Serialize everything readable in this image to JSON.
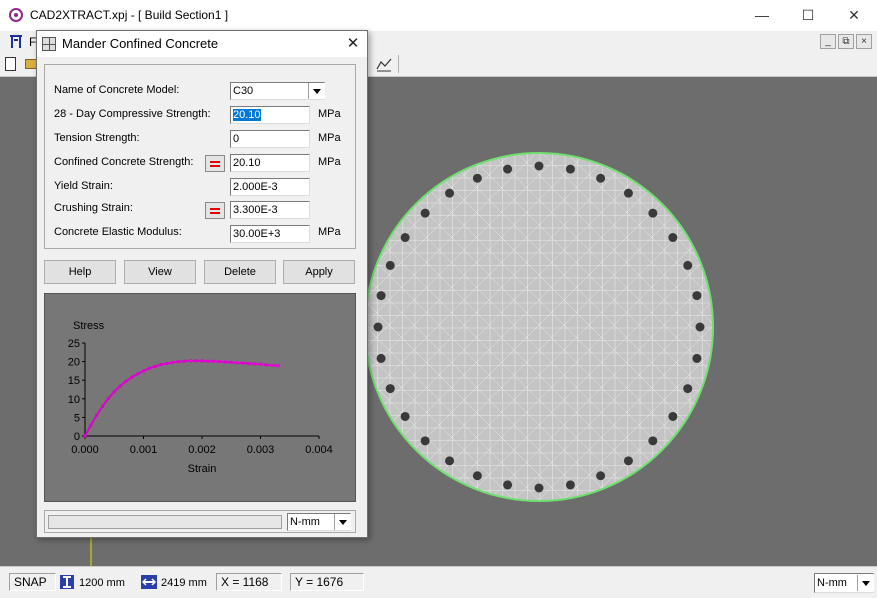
{
  "app": {
    "title": "CAD2XTRACT.xpj - [ Build Section1 ]"
  },
  "menu": {
    "first_item": "F"
  },
  "dialog": {
    "title": "Mander Confined Concrete",
    "fields": {
      "model_label": "Name of Concrete Model:",
      "model_value": "C30",
      "compressive_label": "28 - Day Compressive Strength:",
      "compressive_value": "20.10",
      "compressive_unit": "MPa",
      "tension_label": "Tension Strength:",
      "tension_value": "0",
      "tension_unit": "MPa",
      "confined_label": "Confined Concrete Strength:",
      "confined_value": "20.10",
      "confined_unit": "MPa",
      "yield_label": "Yield Strain:",
      "yield_value": "2.000E-3",
      "crushing_label": "Crushing Strain:",
      "crushing_value": "3.300E-3",
      "modulus_label": "Concrete Elastic Modulus:",
      "modulus_value": "30.00E+3",
      "modulus_unit": "MPa"
    },
    "buttons": {
      "help": "Help",
      "view": "View",
      "delete": "Delete",
      "apply": "Apply"
    },
    "units_select": "N-mm"
  },
  "chart_data": {
    "type": "line",
    "xlabel": "Strain",
    "ylabel": "Stress",
    "xlim": [
      0,
      0.004
    ],
    "ylim": [
      0,
      25
    ],
    "xticks": [
      "0.000",
      "0.001",
      "0.002",
      "0.003",
      "0.004"
    ],
    "yticks": [
      "0",
      "5",
      "10",
      "15",
      "20",
      "25"
    ],
    "series": [
      {
        "color": "#e000d0",
        "x": [
          0,
          0.0001,
          0.0002,
          0.0003,
          0.0004,
          0.0005,
          0.0006,
          0.0007,
          0.0008,
          0.0009,
          0.001,
          0.0011,
          0.0012,
          0.0013,
          0.0014,
          0.0015,
          0.0016,
          0.0017,
          0.0018,
          0.0019,
          0.002,
          0.0021,
          0.0022,
          0.0023,
          0.0024,
          0.0025,
          0.0026,
          0.0027,
          0.0028,
          0.0029,
          0.003,
          0.0031,
          0.0032,
          0.0033
        ],
        "y": [
          0,
          2.9,
          5.6,
          8.0,
          10.1,
          11.9,
          13.4,
          14.7,
          15.8,
          16.7,
          17.5,
          18.2,
          18.7,
          19.2,
          19.5,
          19.8,
          20.0,
          20.1,
          20.2,
          20.2,
          20.2,
          20.1,
          20.1,
          20.0,
          19.9,
          19.8,
          19.7,
          19.6,
          19.5,
          19.4,
          19.3,
          19.1,
          19.0,
          18.9
        ]
      }
    ]
  },
  "status": {
    "snap": "SNAP",
    "height": "1200 mm",
    "width": "2419 mm",
    "x": "X = 1168",
    "y": "Y = 1676",
    "units": "N-mm"
  },
  "colors": {
    "canvas_bg": "#6d6d6d",
    "section_fill": "#c4c4c4",
    "section_outline": "#6ee06e",
    "rebar": "#3a3a3a"
  }
}
